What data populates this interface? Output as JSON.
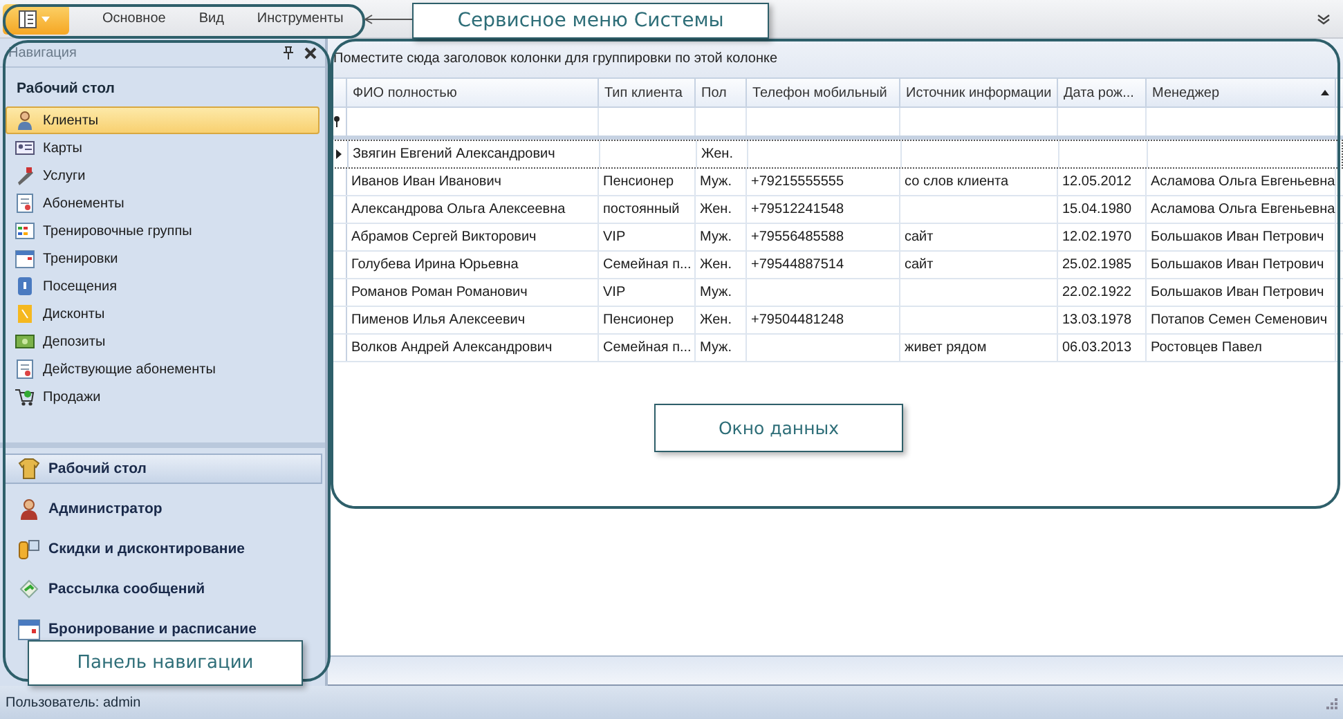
{
  "menu": {
    "tabs": [
      {
        "label": "Основное"
      },
      {
        "label": "Вид"
      },
      {
        "label": "Инструменты"
      }
    ]
  },
  "navigation": {
    "title": "Навигация",
    "group_title": "Рабочий стол",
    "items": [
      {
        "label": "Клиенты",
        "selected": true
      },
      {
        "label": "Карты",
        "selected": false
      },
      {
        "label": "Услуги",
        "selected": false
      },
      {
        "label": "Абонементы",
        "selected": false
      },
      {
        "label": "Тренировочные группы",
        "selected": false
      },
      {
        "label": "Тренировки",
        "selected": false
      },
      {
        "label": "Посещения",
        "selected": false
      },
      {
        "label": "Дисконты",
        "selected": false
      },
      {
        "label": "Депозиты",
        "selected": false
      },
      {
        "label": "Действующие абонементы",
        "selected": false
      },
      {
        "label": "Продажи",
        "selected": false
      }
    ],
    "sections": [
      {
        "label": "Рабочий стол",
        "selected": true
      },
      {
        "label": "Администратор",
        "selected": false
      },
      {
        "label": "Скидки и дисконтирование",
        "selected": false
      },
      {
        "label": "Рассылка сообщений",
        "selected": false
      },
      {
        "label": "Бронирование и расписание",
        "selected": false
      }
    ]
  },
  "grid": {
    "group_hint": "Поместите сюда заголовок колонки для группировки по этой колонке",
    "columns": [
      {
        "label": "ФИО полностью",
        "sorted": false
      },
      {
        "label": "Тип клиента",
        "sorted": false
      },
      {
        "label": "Пол",
        "sorted": false
      },
      {
        "label": "Телефон мобильный",
        "sorted": false
      },
      {
        "label": "Источник информации",
        "sorted": false
      },
      {
        "label": "Дата рож...",
        "sorted": false
      },
      {
        "label": "Менеджер",
        "sorted": true
      }
    ],
    "rows": [
      {
        "selected": true,
        "cells": [
          "Звягин Евгений Александрович",
          "",
          "Жен.",
          "",
          "",
          "",
          ""
        ]
      },
      {
        "selected": false,
        "cells": [
          "Иванов Иван Иванович",
          "Пенсионер",
          "Муж.",
          "+79215555555",
          "со слов клиента",
          "12.05.2012",
          "Асламова Ольга Евгеньевна"
        ]
      },
      {
        "selected": false,
        "cells": [
          "Александрова Ольга Алексеевна",
          "постоянный",
          "Жен.",
          "+79512241548",
          "",
          "15.04.1980",
          "Асламова Ольга Евгеньевна"
        ]
      },
      {
        "selected": false,
        "cells": [
          "Абрамов Сергей Викторович",
          "VIP",
          "Муж.",
          "+79556485588",
          "сайт",
          "12.02.1970",
          "Большаков Иван Петрович"
        ]
      },
      {
        "selected": false,
        "cells": [
          "Голубева Ирина Юрьевна",
          "Семейная п...",
          "Жен.",
          "+79544887514",
          "сайт",
          "25.02.1985",
          "Большаков Иван Петрович"
        ]
      },
      {
        "selected": false,
        "cells": [
          "Романов Роман Романович",
          "VIP",
          "Муж.",
          "",
          "",
          "22.02.1922",
          "Большаков Иван Петрович"
        ]
      },
      {
        "selected": false,
        "cells": [
          "Пименов Илья Алексеевич",
          "Пенсионер",
          "Жен.",
          "+79504481248",
          "",
          "13.03.1978",
          "Потапов Семен Семенович"
        ]
      },
      {
        "selected": false,
        "cells": [
          "Волков Андрей Александрович",
          "Семейная п...",
          "Муж.",
          "",
          "живет рядом",
          "06.03.2013",
          "Ростовцев Павел"
        ]
      }
    ]
  },
  "status_bar": {
    "text": "Пользователь: admin"
  },
  "annotations": [
    {
      "kind": "menu",
      "text": "Сервисное меню Системы"
    },
    {
      "kind": "data",
      "text": "Окно данных"
    },
    {
      "kind": "navigation",
      "text": "Панель навигации"
    }
  ]
}
